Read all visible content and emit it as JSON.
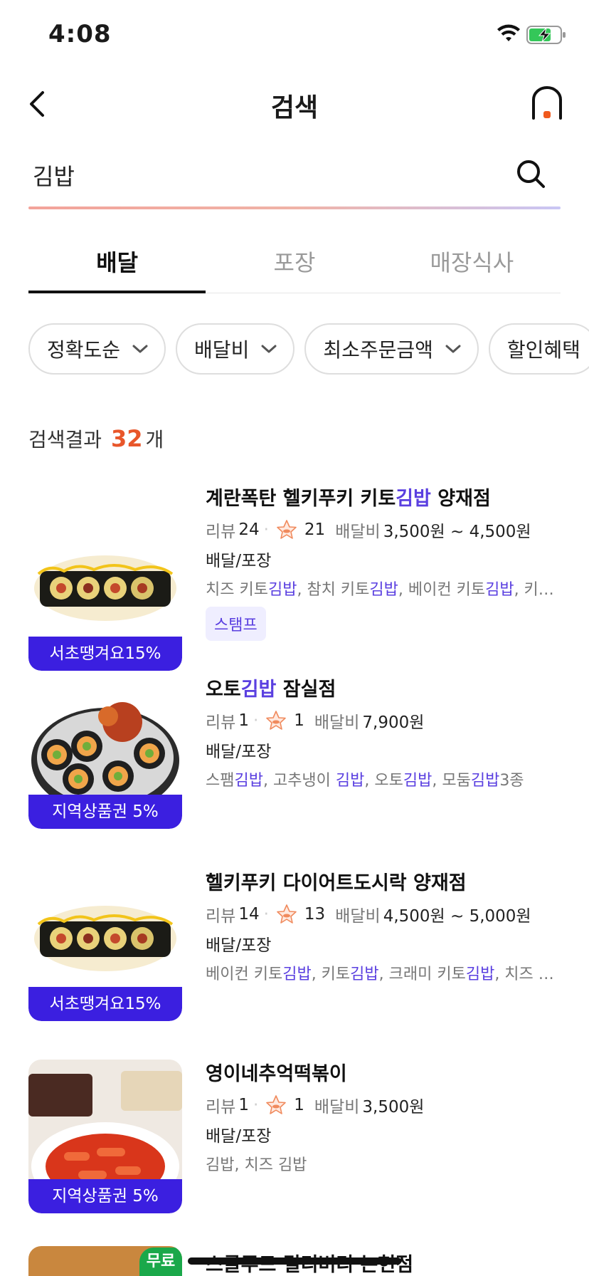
{
  "status": {
    "time": "4:08"
  },
  "nav": {
    "title": "검색"
  },
  "search": {
    "value": "김밥"
  },
  "tabs": [
    {
      "label": "배달",
      "active": true
    },
    {
      "label": "포장",
      "active": false
    },
    {
      "label": "매장식사",
      "active": false
    }
  ],
  "filters": [
    {
      "label": "정확도순"
    },
    {
      "label": "배달비"
    },
    {
      "label": "최소주문금액"
    },
    {
      "label": "할인혜택"
    }
  ],
  "results": {
    "label_prefix": "검색결과",
    "count": "32",
    "label_suffix": "개"
  },
  "stores": [
    {
      "name_parts": [
        "계란폭탄 헬키푸키 키토",
        "김밥",
        " 양재점"
      ],
      "review_label": "리뷰",
      "reviews": "24",
      "stamps": "21",
      "fee_label": "배달비",
      "fee": "3,500원 ~ 4,500원",
      "type": "배달/포장",
      "menus": "치즈 키토김밥, 참치 키토김밥, 베이컨 키토김밥, 키…",
      "badge": "서초땡겨요15%",
      "stamp": "스탬프"
    },
    {
      "name_parts": [
        "오토",
        "김밥",
        " 잠실점"
      ],
      "review_label": "리뷰",
      "reviews": "1",
      "stamps": "1",
      "fee_label": "배달비",
      "fee": "7,900원",
      "type": "배달/포장",
      "menus": "스팸김밥, 고추냉이 김밥, 오토김밥, 모둠김밥3종",
      "badge": "지역상품권 5%"
    },
    {
      "name_parts": [
        "헬키푸키 다이어트도시락 양재점",
        "",
        ""
      ],
      "review_label": "리뷰",
      "reviews": "14",
      "stamps": "13",
      "fee_label": "배달비",
      "fee": "4,500원 ~ 5,000원",
      "type": "배달/포장",
      "menus": "베이컨 키토김밥, 키토김밥, 크래미 키토김밥, 치즈 …",
      "badge": "서초땡겨요15%"
    },
    {
      "name_parts": [
        "영이네추억떡볶이",
        "",
        ""
      ],
      "review_label": "리뷰",
      "reviews": "1",
      "stamps": "1",
      "fee_label": "배달비",
      "fee": "3,500원",
      "type": "배달/포장",
      "menus": "김밥, 치즈 김밥",
      "badge": "지역상품권 5%"
    }
  ],
  "last_store": {
    "name": "스글푸드 딜리버리 논현점",
    "badge": "무료"
  },
  "colors": {
    "accent": "#e8562a",
    "highlight": "#5a3fe0",
    "badge_bg": "#3b1fe0",
    "free_badge": "#1aa84a"
  }
}
